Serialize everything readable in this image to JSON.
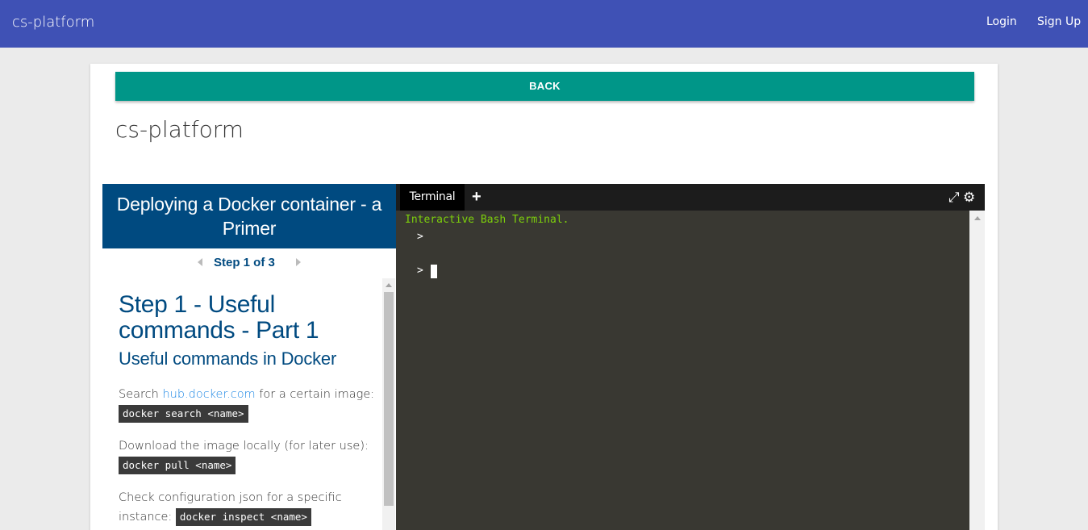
{
  "navbar": {
    "brand": "cs-platform",
    "login_label": "Login",
    "signup_label": "Sign Up"
  },
  "page": {
    "back_label": "BACK",
    "title": "cs-platform"
  },
  "tutorial": {
    "header": "Deploying a Docker container - a Primer",
    "step_label": "Step 1 of 3",
    "step_title": "Step 1 - Useful commands - Part 1",
    "step_subtitle": "Useful commands in Docker",
    "paragraphs": [
      {
        "before": "Search ",
        "link": "hub.docker.com",
        "after": " for a certain image: ",
        "code": "docker search <name>"
      },
      {
        "before": "Download the image locally (for later use): ",
        "link": "",
        "after": "",
        "code": "docker pull <name>"
      },
      {
        "before": "Check configuration json for a specific instance: ",
        "link": "",
        "after": "",
        "code": "docker inspect <name>"
      }
    ]
  },
  "terminal": {
    "tab_label": "Terminal",
    "add_tab": "+",
    "banner": "Interactive Bash Terminal.",
    "prompt1": ">",
    "prompt2": ">",
    "icons": [
      "expand-icon",
      "gear-icon"
    ],
    "banner_color": "#7dd00b",
    "background_color": "#393832"
  },
  "colors": {
    "navbar": "#3f51b5",
    "back_button": "#009688",
    "tutorial_header": "#004a80"
  }
}
